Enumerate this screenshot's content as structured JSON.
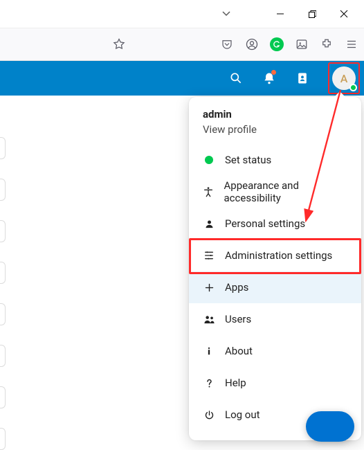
{
  "window": {
    "chevron": "⌄"
  },
  "header": {
    "avatar_initial": "A"
  },
  "menu": {
    "username": "admin",
    "view_profile": "View profile",
    "items": [
      {
        "label": "Set status",
        "icon": "status"
      },
      {
        "label": "Appearance and accessibility",
        "icon": "accessibility"
      },
      {
        "label": "Personal settings",
        "icon": "person"
      },
      {
        "label": "Administration settings",
        "icon": "admin"
      },
      {
        "label": "Apps",
        "icon": "plus",
        "hover": true
      },
      {
        "label": "Users",
        "icon": "users"
      },
      {
        "label": "About",
        "icon": "info"
      },
      {
        "label": "Help",
        "icon": "help"
      },
      {
        "label": "Log out",
        "icon": "power"
      }
    ]
  },
  "annotation": {
    "highlight": "Administration settings",
    "arrow_from": "avatar",
    "arrow_to": "administration-settings"
  },
  "colors": {
    "brand": "#0082c9",
    "annotation": "#ff2a2a",
    "online": "#00c950"
  }
}
